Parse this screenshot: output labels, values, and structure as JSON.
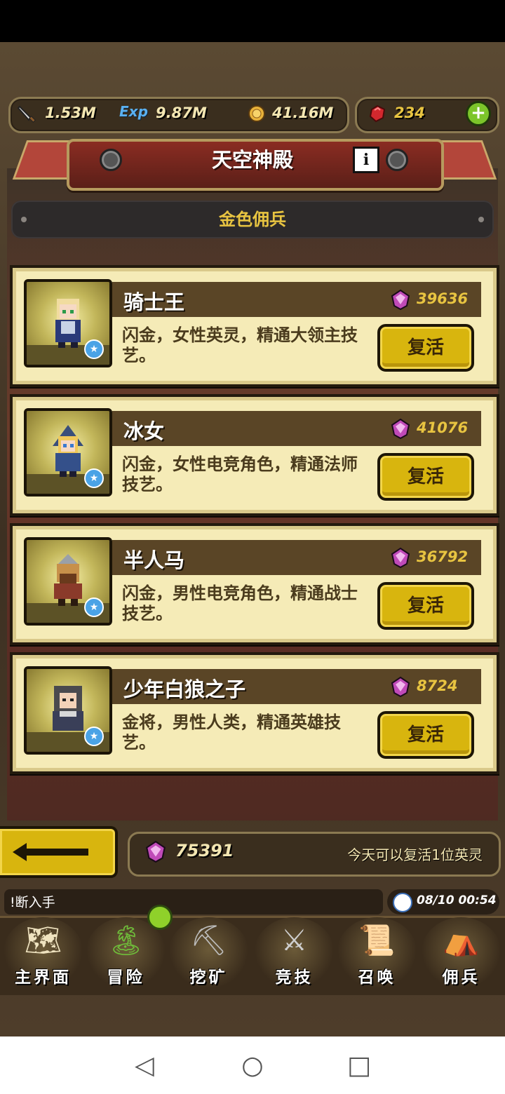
{
  "resources": {
    "attack": "1.53M",
    "exp_label": "Exp",
    "exp": "9.87M",
    "gold": "41.16M",
    "rubies": "234",
    "add_symbol": "+"
  },
  "title": "天空神殿",
  "info_symbol": "i",
  "section_title": "金色佣兵",
  "heroes": [
    {
      "name": "骑士王",
      "gems": "39636",
      "desc": "闪金，女性英灵，精通大领主技艺。",
      "button": "复活"
    },
    {
      "name": "冰女",
      "gems": "41076",
      "desc": "闪金，女性电竞角色，精通法师技艺。",
      "button": "复活"
    },
    {
      "name": "半人马",
      "gems": "36792",
      "desc": "闪金，男性电竞角色，精通战士技艺。",
      "button": "复活"
    },
    {
      "name": "少年白狼之子",
      "gems": "8724",
      "desc": "金将，男性人类，精通英雄技艺。",
      "button": "复活"
    }
  ],
  "bottom": {
    "gem_total": "75391",
    "revive_note": "今天可以复活1位英灵"
  },
  "ticker": "!断入手",
  "clock": "08/10 00:54",
  "nav": [
    {
      "label": "主界面",
      "icon": "map-scroll-icon"
    },
    {
      "label": "冒险",
      "icon": "island-icon"
    },
    {
      "label": "挖矿",
      "icon": "pickaxe-icon"
    },
    {
      "label": "竞技",
      "icon": "crossed-swords-icon"
    },
    {
      "label": "召唤",
      "icon": "summon-scroll-icon"
    },
    {
      "label": "佣兵",
      "icon": "tent-icon"
    }
  ],
  "colors": {
    "accent_gold": "#e8c441",
    "button_yellow": "#d8b50e",
    "card_bg": "#f5ebb7",
    "banner_red": "#8a2c22"
  }
}
